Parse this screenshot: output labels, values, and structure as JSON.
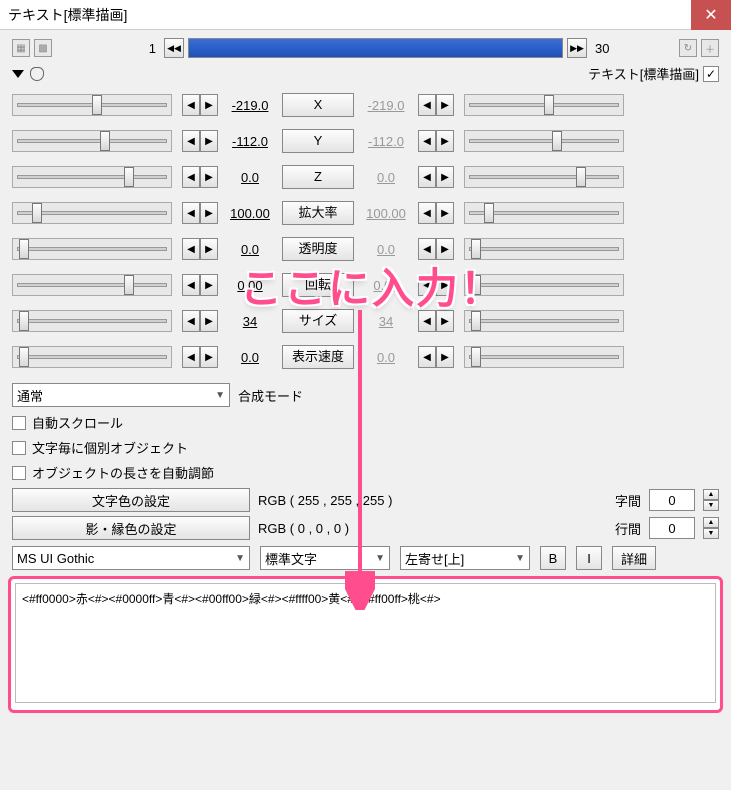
{
  "title": "テキスト[標準描画]",
  "timeline": {
    "start": "1",
    "end": "30"
  },
  "header_label": "テキスト[標準描画]",
  "params": [
    {
      "name": "X",
      "left": "-219.0",
      "right": "-219.0",
      "thumbL": 50,
      "thumbR": 50
    },
    {
      "name": "Y",
      "left": "-112.0",
      "right": "-112.0",
      "thumbL": 55,
      "thumbR": 55
    },
    {
      "name": "Z",
      "left": "0.0",
      "right": "0.0",
      "thumbL": 70,
      "thumbR": 70
    },
    {
      "name": "拡大率",
      "left": "100.00",
      "right": "100.00",
      "thumbL": 12,
      "thumbR": 12
    },
    {
      "name": "透明度",
      "left": "0.0",
      "right": "0.0",
      "thumbL": 4,
      "thumbR": 4
    },
    {
      "name": "回転",
      "left": "0.00",
      "right": "0.00",
      "thumbL": 70,
      "thumbR": 4
    },
    {
      "name": "サイズ",
      "left": "34",
      "right": "34",
      "thumbL": 4,
      "thumbR": 4
    },
    {
      "name": "表示速度",
      "left": "0.0",
      "right": "0.0",
      "thumbL": 4,
      "thumbR": 4
    }
  ],
  "blend_label": "合成モード",
  "blend_value": "通常",
  "checks": {
    "auto_scroll": "自動スクロール",
    "per_char": "文字毎に個別オブジェクト",
    "auto_length": "オブジェクトの長さを自動調節"
  },
  "text_color_btn": "文字色の設定",
  "text_color_rgb": "RGB ( 255 , 255 , 255 )",
  "shadow_color_btn": "影・縁色の設定",
  "shadow_color_rgb": "RGB ( 0 , 0 , 0 )",
  "spacing_label": "字間",
  "spacing_val": "0",
  "linespace_label": "行間",
  "linespace_val": "0",
  "font": "MS UI Gothic",
  "rendering": "標準文字",
  "align": "左寄せ[上]",
  "bold": "B",
  "italic": "I",
  "detail": "詳細",
  "text_input": "<#ff0000>赤<#><#0000ff>青<#><#00ff00>緑<#><#ffff00>黄<#><#ff00ff>桃<#>",
  "overlay": "ここに入力！"
}
